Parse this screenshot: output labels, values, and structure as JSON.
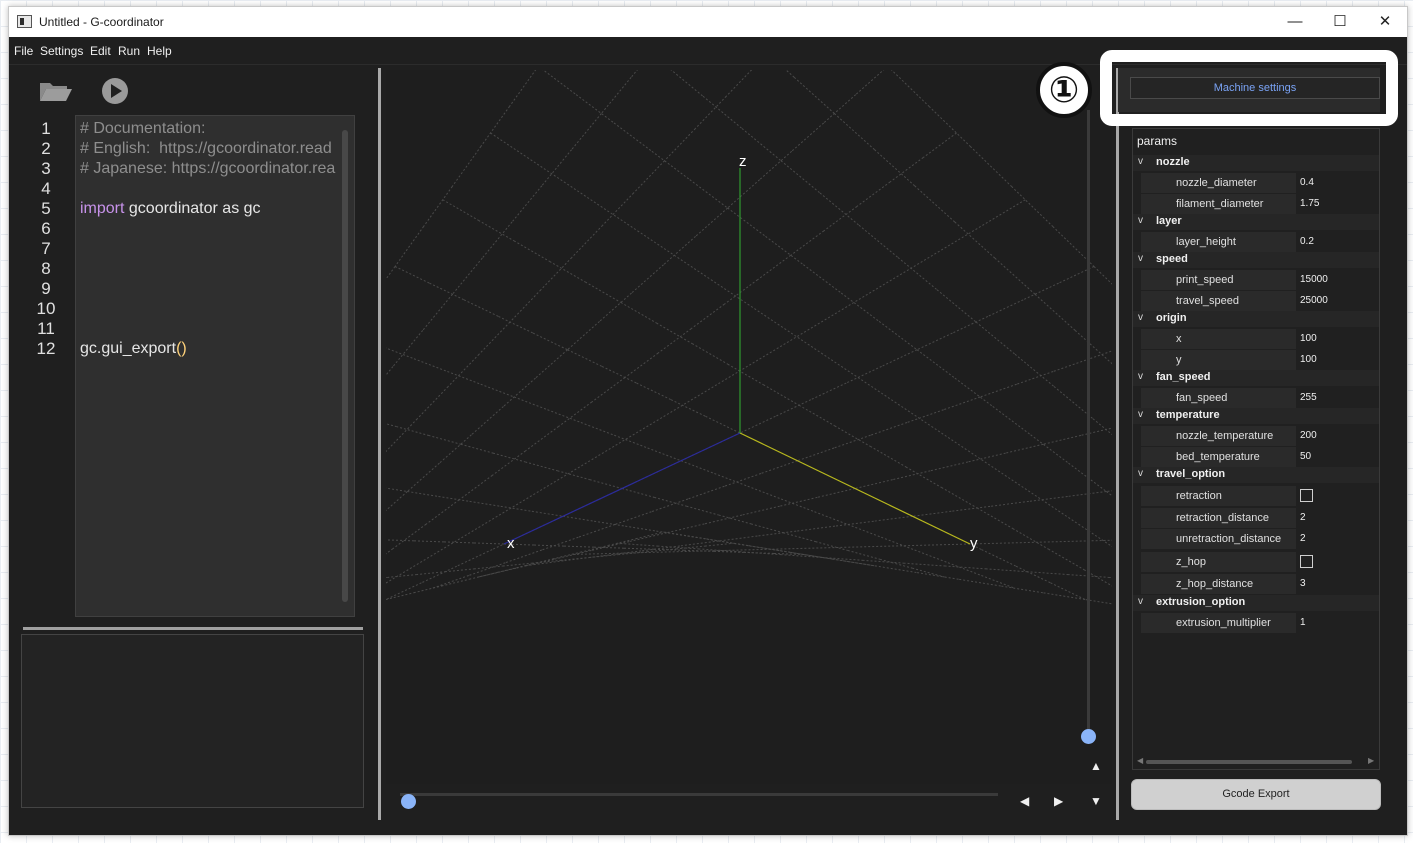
{
  "window": {
    "title": "Untitled - G-coordinator",
    "min_glyph": "—",
    "max_glyph": "☐",
    "close_glyph": "✕"
  },
  "menu": [
    "File",
    "Settings",
    "Edit",
    "Run",
    "Help"
  ],
  "toolbar": {
    "open_icon": "folder-icon",
    "run_icon": "play-icon"
  },
  "editor": {
    "line_numbers": [
      "1",
      "2",
      "3",
      "4",
      "5",
      "6",
      "7",
      "8",
      "9",
      "10",
      "11",
      "12"
    ],
    "lines": {
      "l1": "# Documentation:",
      "l2": "# English:  https://gcoordinator.read",
      "l3": "# Japanese: https://gcoordinator.rea",
      "l5_kw": "import",
      "l5_rest": " gcoordinator as gc",
      "l12_obj": "gc.",
      "l12_fn": "gui_export",
      "l12_paren": "()"
    }
  },
  "viewport": {
    "axis_labels": {
      "x": "x",
      "y": "y",
      "z": "z"
    },
    "axis_colors": {
      "x": "#2b2b9c",
      "y": "#b8b81c",
      "z": "#2f9a2f"
    },
    "grid_color": "#4a4a4a",
    "layer_slider_value": 1,
    "path_slider_value": 0,
    "controls": {
      "left": "◀",
      "right": "▶",
      "up": "▲",
      "down": "▼"
    }
  },
  "callout": {
    "label": "①"
  },
  "right_panel": {
    "tab_label": "Machine settings",
    "tree_header": "params",
    "chevron": "v",
    "groups": {
      "nozzle": {
        "name": "nozzle",
        "nozzle_diameter": {
          "label": "nozzle_diameter",
          "value": "0.4"
        },
        "filament_diameter": {
          "label": "filament_diameter",
          "value": "1.75"
        }
      },
      "layer": {
        "name": "layer",
        "layer_height": {
          "label": "layer_height",
          "value": "0.2"
        }
      },
      "speed": {
        "name": "speed",
        "print_speed": {
          "label": "print_speed",
          "value": "15000"
        },
        "travel_speed": {
          "label": "travel_speed",
          "value": "25000"
        }
      },
      "origin": {
        "name": "origin",
        "x": {
          "label": "x",
          "value": "100"
        },
        "y": {
          "label": "y",
          "value": "100"
        }
      },
      "fan_speed": {
        "name": "fan_speed",
        "fan_speed": {
          "label": "fan_speed",
          "value": "255"
        }
      },
      "temperature": {
        "name": "temperature",
        "nozzle_temperature": {
          "label": "nozzle_temperature",
          "value": "200"
        },
        "bed_temperature": {
          "label": "bed_temperature",
          "value": "50"
        }
      },
      "travel_option": {
        "name": "travel_option",
        "retraction": {
          "label": "retraction",
          "checked": false
        },
        "retraction_distance": {
          "label": "retraction_distance",
          "value": "2"
        },
        "unretraction_distance": {
          "label": "unretraction_distance",
          "value": "2"
        },
        "z_hop": {
          "label": "z_hop",
          "checked": false
        },
        "z_hop_distance": {
          "label": "z_hop_distance",
          "value": "3"
        }
      },
      "extrusion_option": {
        "name": "extrusion_option",
        "extrusion_multiplier": {
          "label": "extrusion_multiplier",
          "value": "1"
        }
      }
    },
    "export_button": "Gcode Export"
  }
}
